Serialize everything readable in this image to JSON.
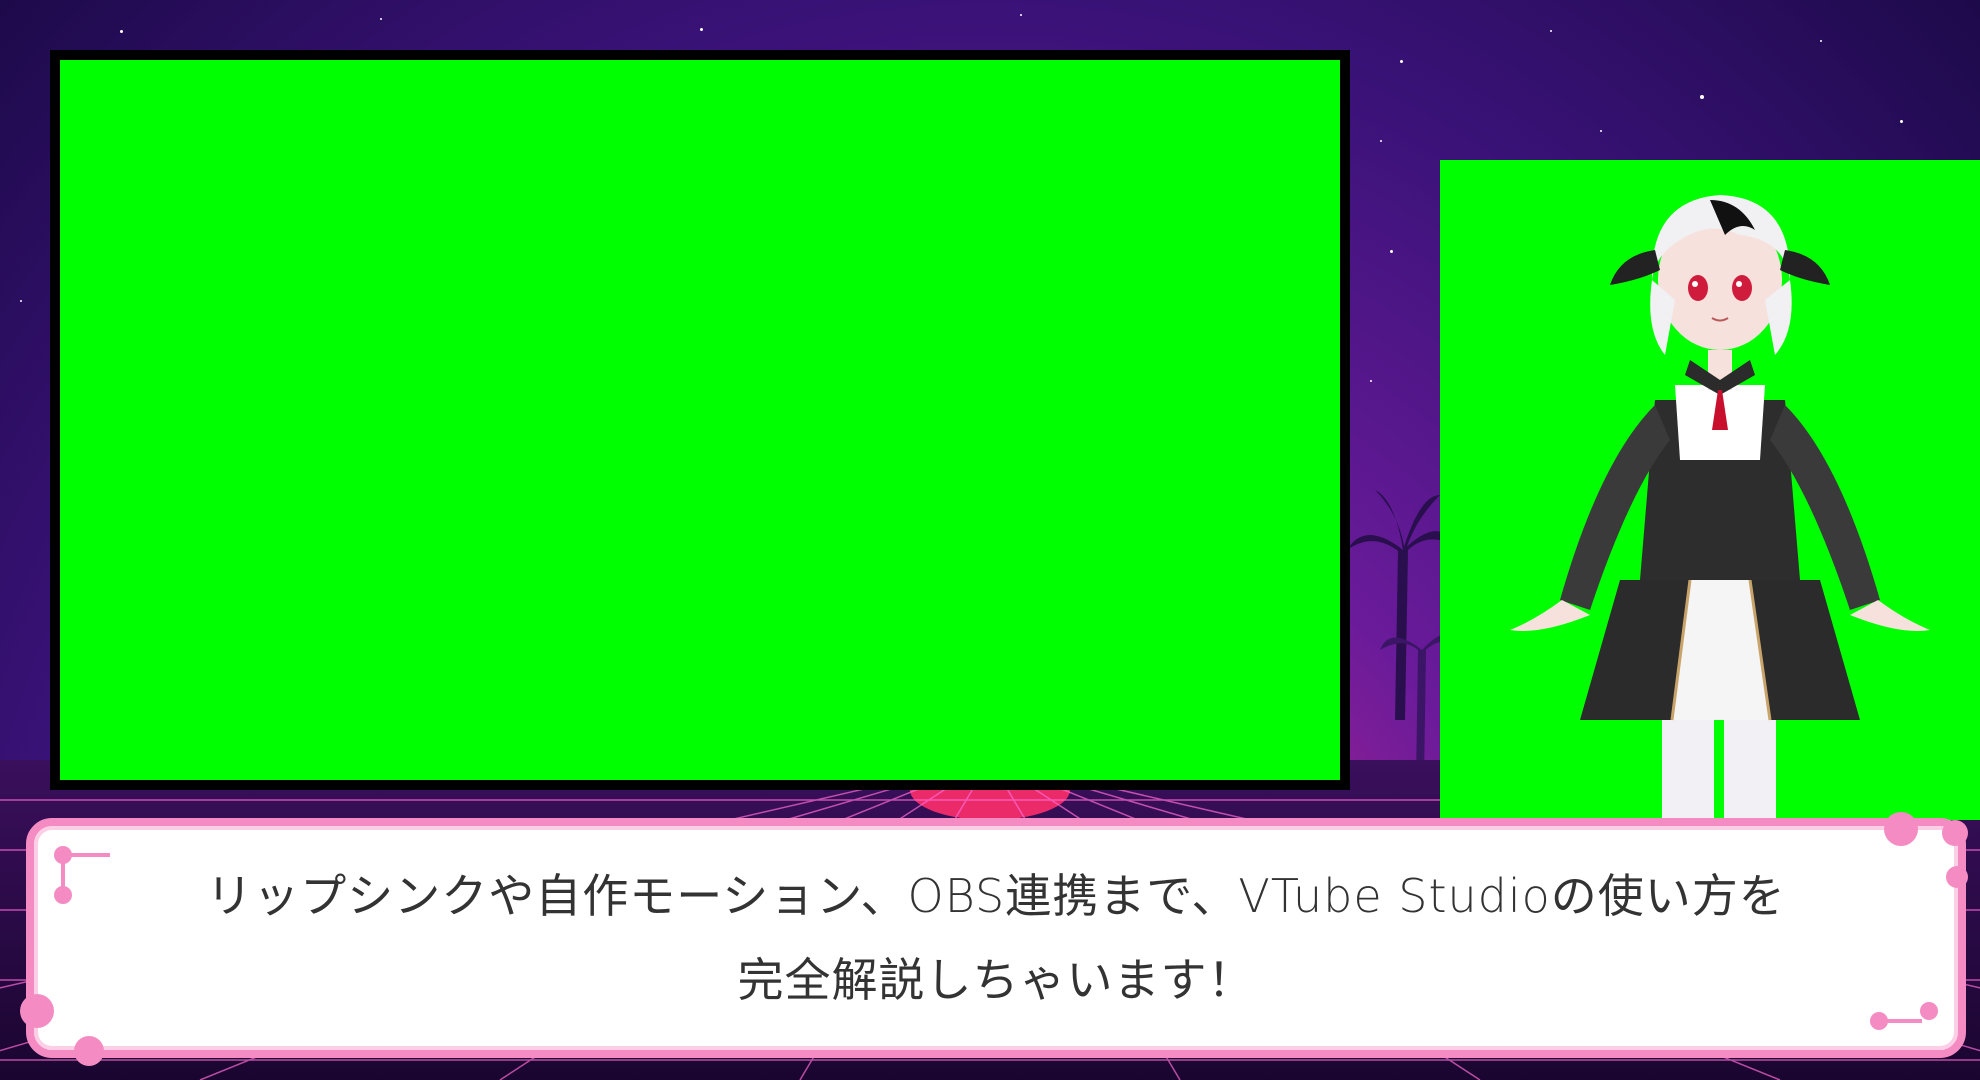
{
  "scene": {
    "background_colors": [
      "#1d0a4a",
      "#6a1b9a",
      "#b0248f",
      "#ff3f8e"
    ],
    "screen_color": "#00ff00",
    "frame_color": "#000000",
    "caption_border_color": "#f48cc3"
  },
  "caption": {
    "text": "リップシンクや自作モーション、OBS連携まで、VTube Studioの使い方を完全解説しちゃいます！"
  },
  "icons": {
    "corner_deco": "circuit-node-icon"
  }
}
